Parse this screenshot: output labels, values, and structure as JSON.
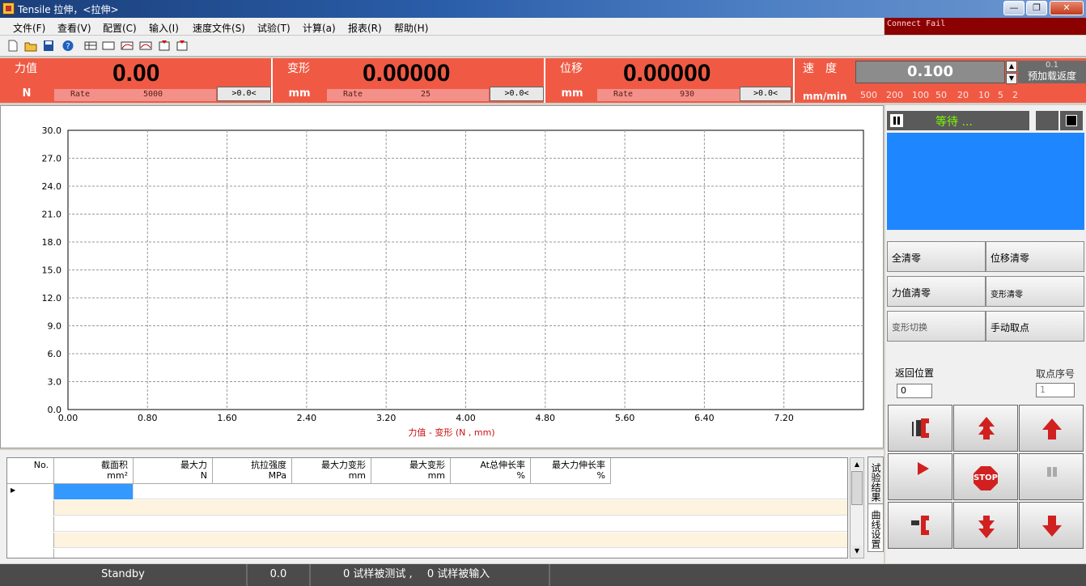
{
  "window": {
    "title": "Tensile 拉伸，<拉伸>",
    "connect_status": "Connect Fail"
  },
  "menu": [
    "文件(F)",
    "查看(V)",
    "配置(C)",
    "输入(I)",
    "速度文件(S)",
    "试验(T)",
    "计算(a)",
    "报表(R)",
    "帮助(H)"
  ],
  "toolbar_icons": [
    "new-file-icon",
    "open-folder-icon",
    "save-icon",
    "help-icon",
    "table-icon",
    "blank-icon",
    "curve-icon",
    "curve2-icon",
    "report-icon",
    "report2-icon"
  ],
  "readouts": {
    "force": {
      "label": "力值",
      "unit": "N",
      "value": "0.00",
      "rate_label": "Rate",
      "rate_value": "5000",
      "zero_btn": ">0.0<"
    },
    "deform": {
      "label": "变形",
      "unit": "mm",
      "value": "0.00000",
      "rate_label": "Rate",
      "rate_value": "25",
      "zero_btn": ">0.0<"
    },
    "disp": {
      "label": "位移",
      "unit": "mm",
      "value": "0.00000",
      "rate_label": "Rate",
      "rate_value": "930",
      "zero_btn": ">0.0<"
    }
  },
  "speed": {
    "title": "速度",
    "unit": "mm/min",
    "value": "0.100",
    "preload_value": "0.1",
    "preload_label": "预加载返度",
    "scale": [
      "500",
      "200",
      "100",
      "50",
      "20",
      "10",
      "5",
      "2"
    ]
  },
  "chart_data": {
    "type": "line",
    "title": "",
    "xlabel": "力值 - 变形    (N , mm)",
    "ylabel": "",
    "xlim": [
      0,
      8.0
    ],
    "ylim": [
      0,
      30
    ],
    "xticks": [
      "0.00",
      "0.80",
      "1.60",
      "2.40",
      "3.20",
      "4.00",
      "4.80",
      "5.60",
      "6.40",
      "7.20"
    ],
    "yticks": [
      "0.0",
      "3.0",
      "6.0",
      "9.0",
      "12.0",
      "15.0",
      "18.0",
      "21.0",
      "24.0",
      "27.0",
      "30.0"
    ],
    "grid": true,
    "series": []
  },
  "side": {
    "wait_text": "等待 ...",
    "btn_zero_all": "全清零",
    "btn_zero_disp": "位移清零",
    "btn_zero_force": "力值清零",
    "btn_zero_deform": "变形清零",
    "btn_deform_switch": "变形切换",
    "btn_manual_point": "手动取点",
    "return_pos_label": "返回位置",
    "return_pos_value": "0",
    "point_seq_label": "取点序号",
    "point_seq_value": "1",
    "stop_label": "STOP"
  },
  "table": {
    "headers": [
      {
        "l1": "No.",
        "l2": ""
      },
      {
        "l1": "截面积",
        "l2": "mm²"
      },
      {
        "l1": "最大力",
        "l2": "N"
      },
      {
        "l1": "抗拉强度",
        "l2": "MPa"
      },
      {
        "l1": "最大力变形",
        "l2": "mm"
      },
      {
        "l1": "最大变形",
        "l2": "mm"
      },
      {
        "l1": "At总伸长率",
        "l2": "%"
      },
      {
        "l1": "最大力伸长率",
        "l2": "%"
      }
    ],
    "tabs": [
      "试验结果",
      "曲线设置"
    ]
  },
  "statusbar": {
    "state": "Standby",
    "value": "0.0",
    "tested": "0  试样被测试 ,",
    "input": "0  试样被输入"
  }
}
